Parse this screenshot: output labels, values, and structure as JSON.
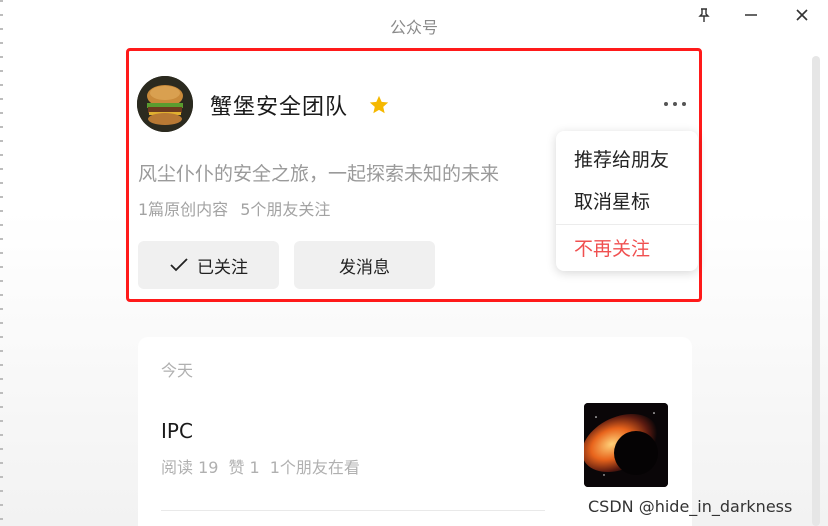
{
  "window": {
    "title": "公众号",
    "buttons": [
      "pin-icon",
      "minimize-icon",
      "close-icon"
    ]
  },
  "profile": {
    "name": "蟹堡安全团队",
    "bio": "风尘仆仆的安全之旅，一起探索未知的未来",
    "stats": {
      "originals": "1篇原创内容",
      "friends_following": "5个朋友关注"
    },
    "buttons": {
      "followed": "已关注",
      "message": "发消息"
    },
    "icons": {
      "star": "star-icon",
      "more": "more-icon",
      "check": "check-icon"
    },
    "colors": {
      "star": "#f5b800",
      "highlight_border": "#ff1a1a"
    }
  },
  "menu": {
    "items": [
      {
        "label": "推荐给朋友"
      },
      {
        "label": "取消星标"
      },
      {
        "label": "不再关注",
        "color": "#f05050"
      }
    ]
  },
  "feed": {
    "date_label": "今天",
    "article": {
      "title": "IPC",
      "reads": "阅读 19",
      "likes": "赞 1",
      "friends_viewing": "1个朋友在看"
    }
  },
  "watermark": "CSDN @hide_in_darkness"
}
